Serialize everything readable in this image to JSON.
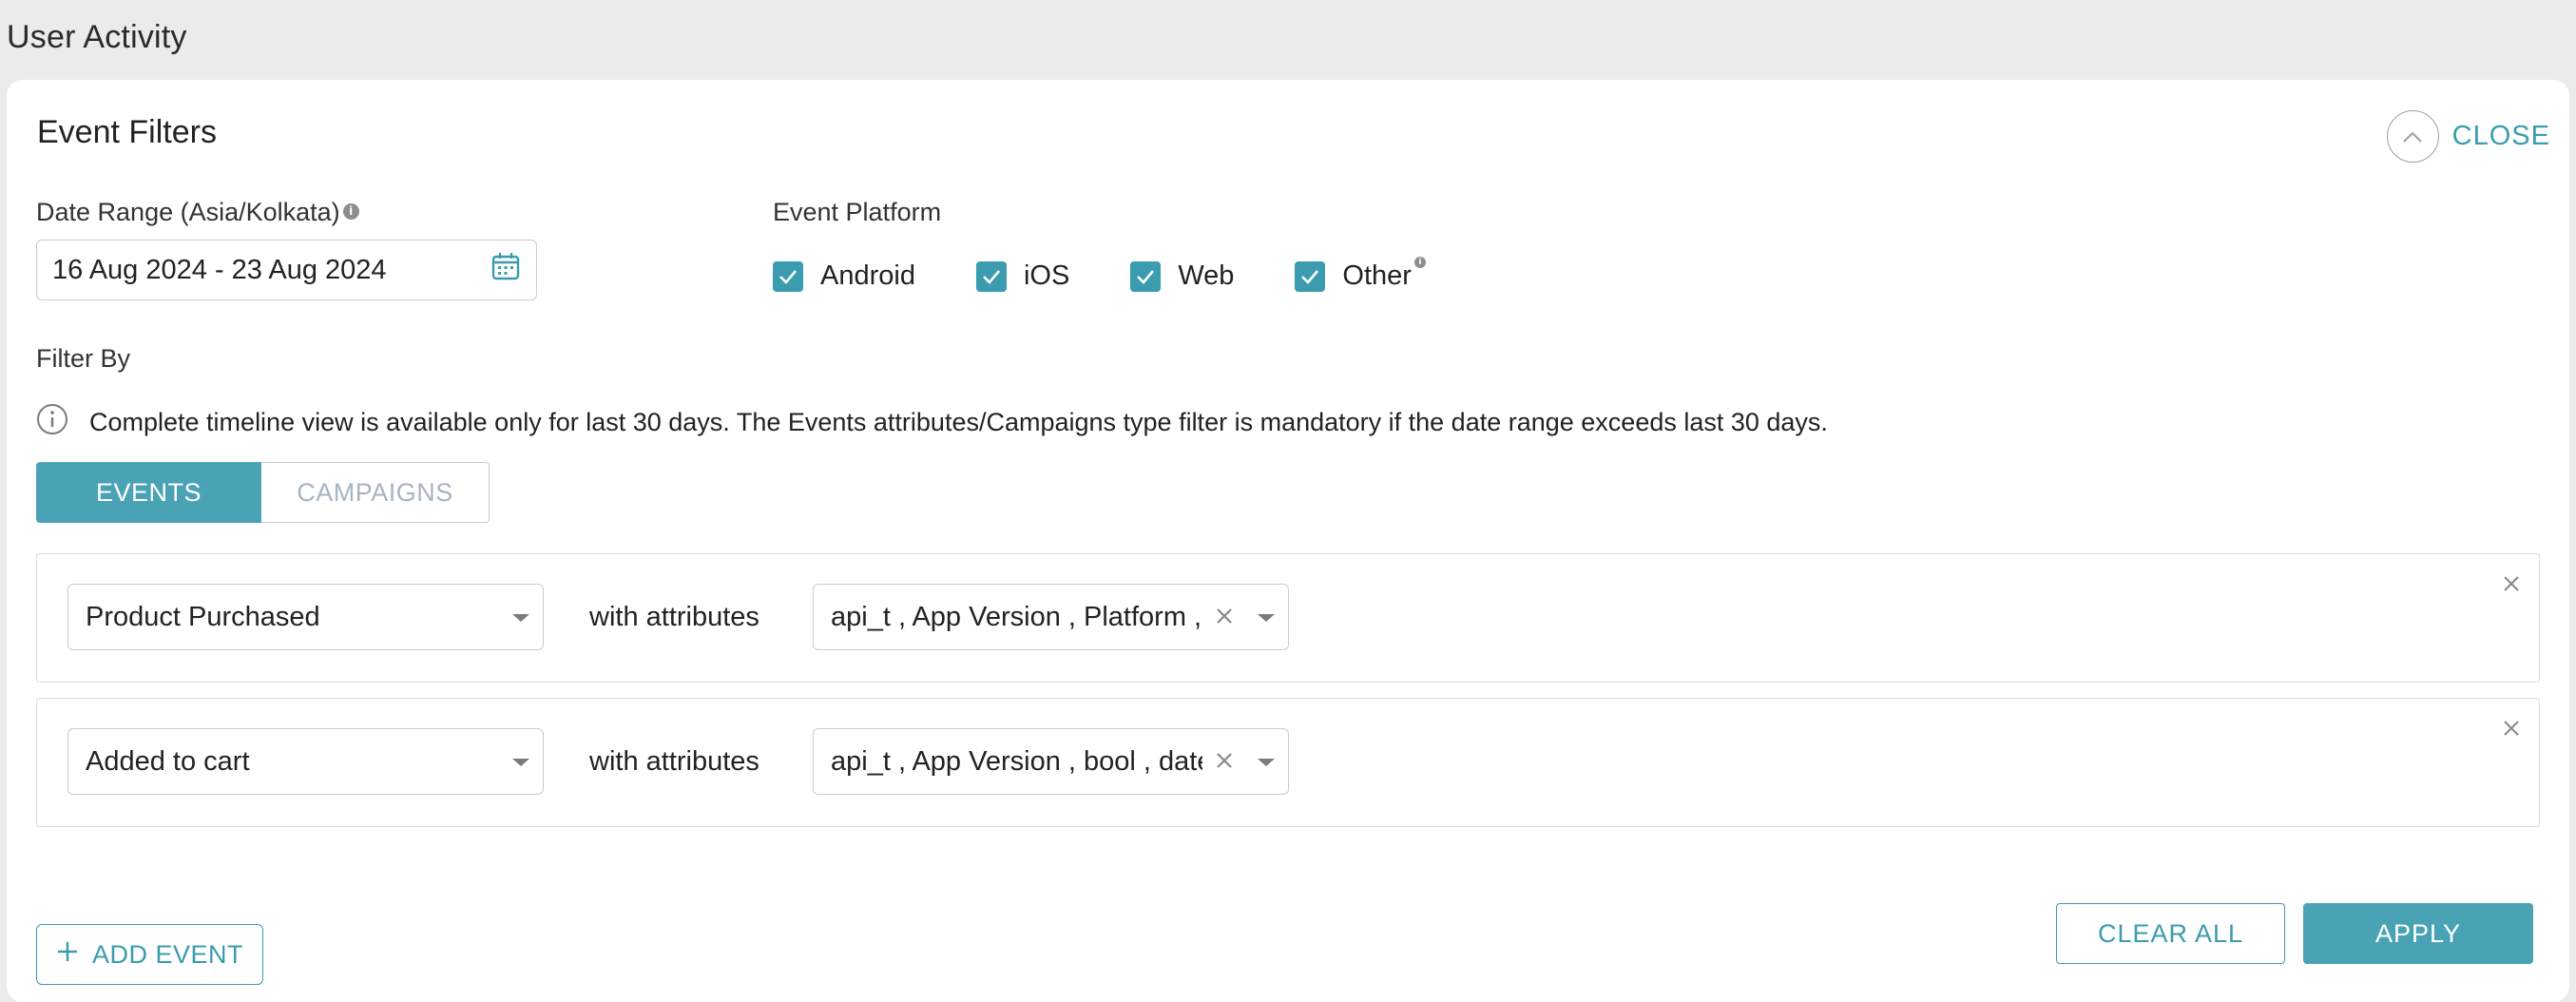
{
  "page": {
    "title": "User Activity"
  },
  "filters": {
    "title": "Event Filters",
    "close_label": "CLOSE",
    "date_range": {
      "label": "Date Range (Asia/Kolkata)",
      "value": "16 Aug 2024 - 23 Aug 2024"
    },
    "platform": {
      "label": "Event Platform",
      "options": [
        {
          "label": "Android",
          "checked": true
        },
        {
          "label": "iOS",
          "checked": true
        },
        {
          "label": "Web",
          "checked": true
        },
        {
          "label": "Other",
          "checked": true
        }
      ]
    },
    "filter_by_label": "Filter By",
    "notice": "Complete timeline view is available only for last 30 days. The Events attributes/Campaigns type filter is mandatory if the date range exceeds last 30 days.",
    "tabs": [
      {
        "label": "EVENTS",
        "active": true
      },
      {
        "label": "CAMPAIGNS",
        "active": false
      }
    ],
    "events": [
      {
        "event": "Product Purchased",
        "with_label": "with attributes",
        "attributes": "api_t , App Version , Platform , S"
      },
      {
        "event": "Added to cart",
        "with_label": "with attributes",
        "attributes": "api_t , App Version , bool , date"
      }
    ],
    "add_event_label": "ADD EVENT",
    "clear_all_label": "CLEAR ALL",
    "apply_label": "APPLY"
  },
  "colors": {
    "accent": "#3a9cae",
    "accent_fill": "#4aa3b5",
    "background": "#ebebeb"
  }
}
